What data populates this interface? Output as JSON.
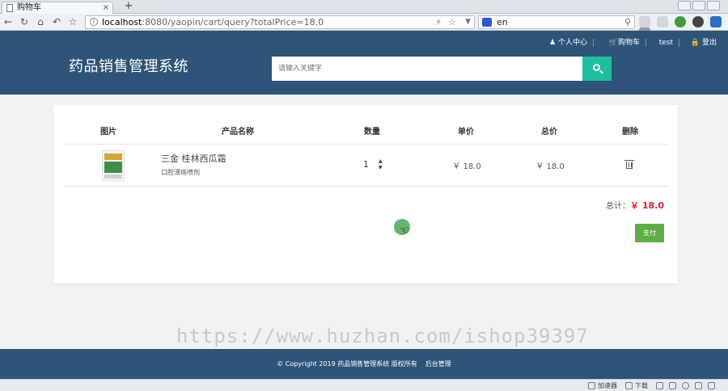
{
  "browser": {
    "tab_title": "购物车",
    "tab_close": "×",
    "new_tab": "+",
    "url_host": "localhost",
    "url_rest": ":8080/yaopin/cart/query?totalPrice=18.0",
    "search_engine_text": "en",
    "nav_icons": [
      "back-icon",
      "refresh-icon",
      "home-icon",
      "undo-icon",
      "favorite-icon"
    ]
  },
  "header": {
    "brand": "药品销售管理系统",
    "search_placeholder": "请输入关键字",
    "user_links": {
      "profile": "个人中心",
      "cart": "购物车",
      "username": "test",
      "logout": "登出"
    },
    "icons": {
      "profile": "user-icon",
      "cart": "cart-icon",
      "logout": "lock-icon",
      "search": "search-icon"
    }
  },
  "cart": {
    "columns": [
      "图片",
      "产品名称",
      "数量",
      "单价",
      "总价",
      "删除"
    ],
    "items": [
      {
        "name": "三金 桂林西瓜霜",
        "desc": "口腔溃疡喷剂",
        "quantity": "1",
        "unit_price": "￥ 18.0",
        "total_price": "￥ 18.0"
      }
    ],
    "total_label": "总计：",
    "total_value": "￥ 18.0",
    "pay_label": "支付"
  },
  "watermark": "https://www.huzhan.com/ishop39397",
  "footer": {
    "copyright": "© Copyright 2019 药品销售管理系统 版权所有",
    "admin_link": "后台管理"
  },
  "statusbar": {
    "accelerator": "加速器",
    "download": "下载"
  },
  "colors": {
    "header_bg": "#2e5478",
    "search_button": "#1cc09f",
    "pay_button": "#5cae45",
    "total_red": "#d9232a",
    "page_bg": "#f0f2f4"
  }
}
